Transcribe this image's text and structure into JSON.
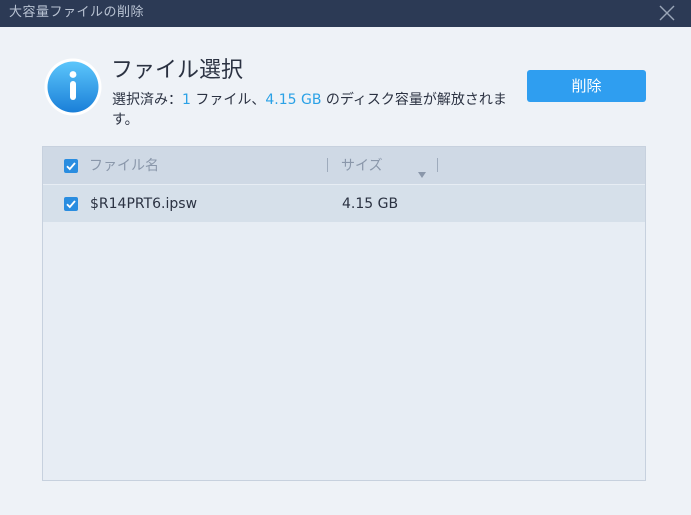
{
  "window": {
    "title": "大容量ファイルの削除",
    "close_icon": "close-icon"
  },
  "header": {
    "icon": "info-icon",
    "title": "ファイル選択",
    "summary": {
      "prefix": "選択済み：",
      "file_count": "1",
      "file_unit": " ファイル、",
      "total_size": "4.15 GB",
      "suffix": " のディスク容量が解放されます。"
    },
    "delete_label": "削除"
  },
  "table": {
    "select_all_checked": true,
    "columns": [
      {
        "label": "ファイル名"
      },
      {
        "label": "サイズ",
        "sort_icon": "sort-down-icon"
      }
    ],
    "rows": [
      {
        "checked": true,
        "name": "$R14PRT6.ipsw",
        "size": "4.15 GB"
      }
    ]
  },
  "colors": {
    "titlebar": "#2c3a55",
    "accent": "#2aa1e6",
    "button": "#2f9ef0",
    "checkbox": "#2a8de0",
    "header_row": "#cfd9e5",
    "selected_row": "#d6e0ea"
  }
}
